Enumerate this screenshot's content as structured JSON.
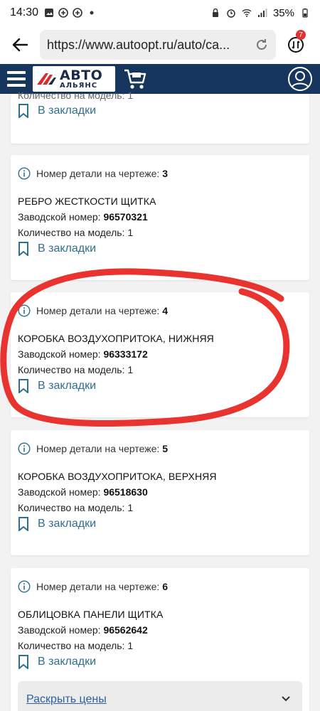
{
  "status": {
    "time": "14:30",
    "battery": "35%"
  },
  "browser": {
    "url": "https://www.autoopt.ru/auto/ca...",
    "ext_badge": "7"
  },
  "site": {
    "logo_top": "АВТО",
    "logo_bottom": "АЛЬЯНС"
  },
  "labels": {
    "drawing_number": "Номер детали на чертеже:",
    "factory_number": "Заводской номер:",
    "quantity": "Количество на модель:",
    "bookmark": "В закладки",
    "partial_quantity": "Количество на модель: 1",
    "expand_prices": "Раскрыть цены"
  },
  "items": [
    {
      "num": "3",
      "name": "РЕБРО ЖЕСТКОСТИ ЩИТКА",
      "factory": "96570321",
      "qty": "1"
    },
    {
      "num": "4",
      "name": "КОРОБКА ВОЗДУХОПРИТОКА, НИЖНЯЯ",
      "factory": "96333172",
      "qty": "1"
    },
    {
      "num": "5",
      "name": "КОРОБКА ВОЗДУХОПРИТОКА, ВЕРХНЯЯ",
      "factory": "96518630",
      "qty": "1"
    },
    {
      "num": "6",
      "name": "ОБЛИЦОВКА ПАНЕЛИ ЩИТКА",
      "factory": "96562642",
      "qty": "1"
    }
  ],
  "colors": {
    "header": "#17365d",
    "link": "#2f6f8f",
    "highlight": "#e8332f"
  }
}
